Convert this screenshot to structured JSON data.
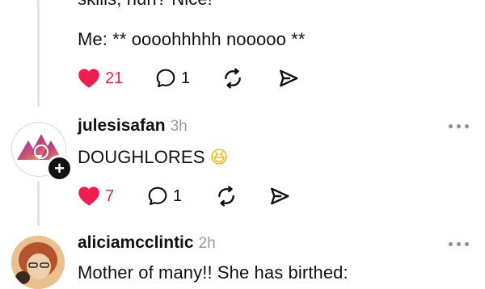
{
  "post_top": {
    "text_line_1": "skills, huh? Nice!",
    "text_line_2": "Me: ** oooohhhhh nooooo **",
    "likes": "21",
    "comments": "1",
    "liked": true
  },
  "reply_1": {
    "username": "julesisafan",
    "time": "3h",
    "text": "DOUGHLORES",
    "emoji": "😆",
    "likes": "7",
    "comments": "1",
    "liked": true,
    "follow_symbol": "+"
  },
  "reply_2": {
    "username": "aliciamcclintic",
    "time": "2h",
    "text": "Mother of many!! She has birthed:"
  },
  "icons": {
    "like": "heart-icon",
    "comment": "comment-bubble-icon",
    "repost": "repost-icon",
    "share": "send-icon",
    "more": "more-options-icon"
  },
  "colors": {
    "like_active": "#ef1e4f",
    "muted": "#9a9a9a"
  }
}
